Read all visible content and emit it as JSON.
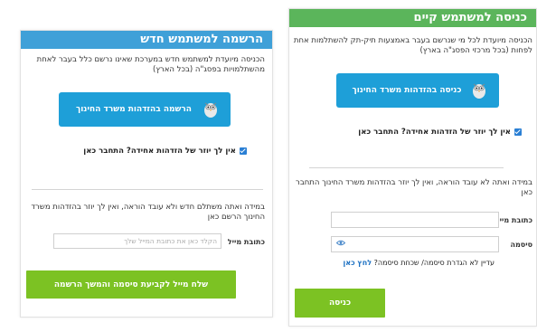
{
  "new_user": {
    "title": "הרשמה למשתמש חדש",
    "intro": "הכניסה מיועדת למשתמש חדש במערכת שאינו נרשם כלל בעבר לאחת מהשתלמויות בפסג\"ה (בכל הארץ)",
    "edu_id_button": "הרשמה בהזדהות משרד החינוך",
    "no_id_text": "אין לך יוזר של הזדהות אחידה? התחבר כאן",
    "teacher_text": "במידה ואתה משתלם חדש ולא עובד הוראה, ואין לך יוזר בהזדהות משרד החינוך הרשם כאן",
    "email_label": "כתובת מייל",
    "email_placeholder": "הקלד כאן את כתובת המייל שלך",
    "submit_button": "שלח מייל לקביעת סיסמה והמשך הרשמה"
  },
  "existing_user": {
    "title": "כניסה למשתמש קיים",
    "intro": "הכניסה מיועדת לכל מי שנרשם בעבר באמצעות תיק-תק להשתלמות אחת לפחות (בכל מרכזי הפסג\"ה בארץ)",
    "edu_id_button": "כניסה בהזדהות משרד החינוך",
    "no_id_text": "אין לך יוזר של הזדהות אחידה? התחבר כאן",
    "teacher_text": "במידה ואתה לא עובד הוראה, ואין לך יוזר בהזדהות משרד החינוך התחבר כאן",
    "email_label": "כתובת מייל",
    "password_label": "סיסמה",
    "forgot_text": "עדיין לא הגדרת סיסמה/ שכחת סיסמה?",
    "forgot_link": "לחץ כאן",
    "login_button": "כניסה"
  },
  "colors": {
    "new_header": "#3fa0d8",
    "existing_header": "#5bb55b",
    "id_button": "#1e9fd8",
    "green_button": "#7cc223",
    "link": "#1a6fc2"
  },
  "icons": {
    "edu_id_button": "owl-mascot-icon",
    "checkbox": "checkbox-checked-icon",
    "password_toggle": "eye-icon"
  }
}
